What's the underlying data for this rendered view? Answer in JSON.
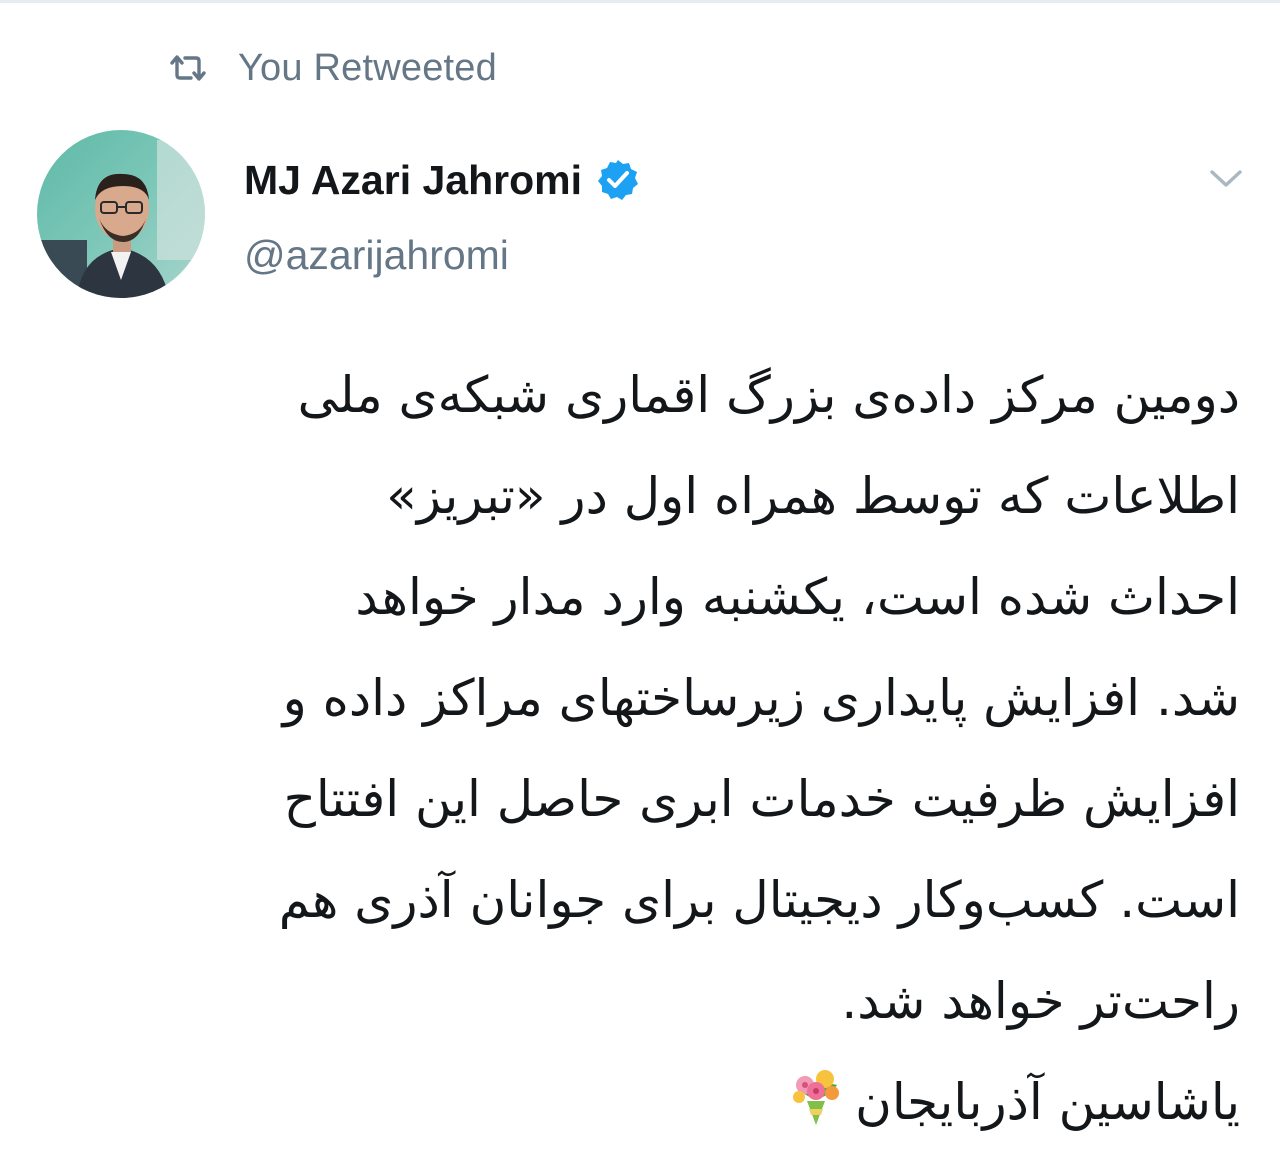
{
  "retweet": {
    "label": "You Retweeted",
    "icon": "retweet-icon"
  },
  "author": {
    "name": "MJ Azari Jahromi",
    "handle": "@azarijahromi",
    "verified": true,
    "verified_icon": "verified-badge-icon",
    "avatar_icon": "avatar"
  },
  "menu": {
    "icon": "chevron-down-icon"
  },
  "tweet": {
    "lines": [
      "دومین مرکز داده‌ی بزرگ اقماری شبکه‌ی ملی",
      "اطلاعات که توسط همراه اول در «تبریز»",
      "احداث شده است، یکشنبه وارد مدار خواهد",
      "شد. افزایش پایداری زیرساختهای مراکز داده و",
      "افزایش ظرفیت خدمات ابری حاصل این افتتاح",
      "است. کسب‌وکار دیجیتال برای جوانان آذری هم",
      "راحت‌تر خواهد شد.",
      "یاشاسین آذربایجان"
    ],
    "emoji_icon": "bouquet-icon"
  },
  "colors": {
    "text": "#14171a",
    "secondary": "#657786",
    "verified": "#1da1f2"
  }
}
